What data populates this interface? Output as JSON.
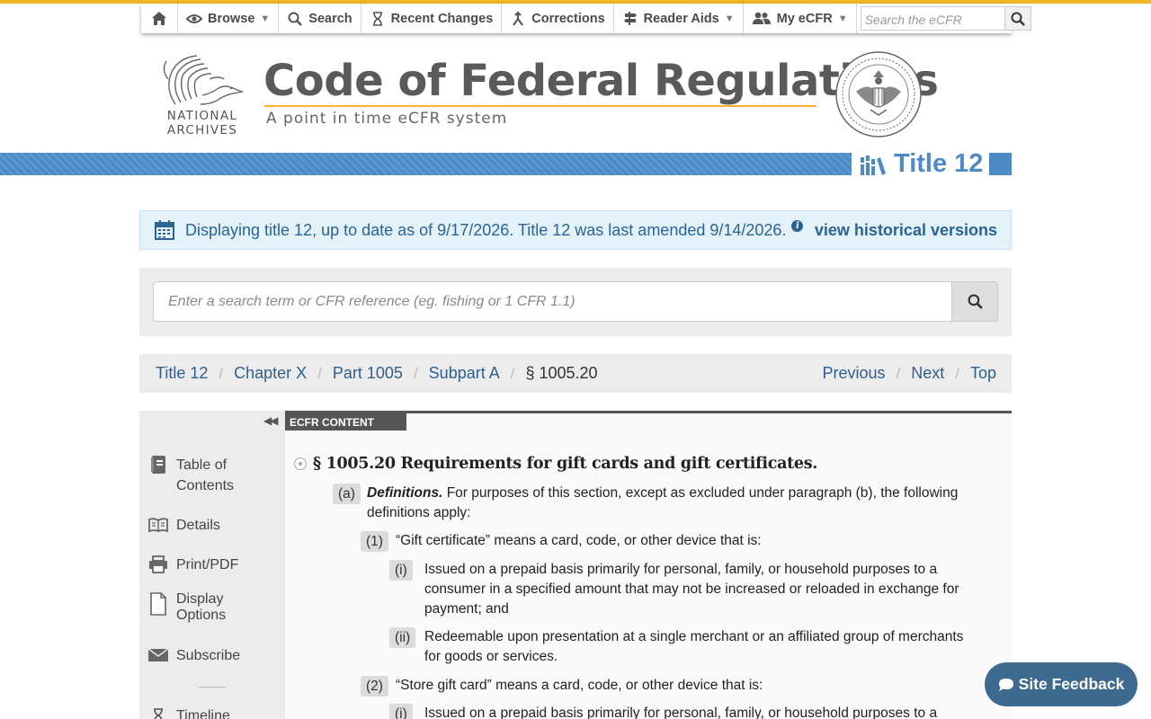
{
  "nav": {
    "browse": "Browse",
    "search": "Search",
    "recent_changes": "Recent Changes",
    "corrections": "Corrections",
    "reader_aids": "Reader Aids",
    "my_ecfr": "My eCFR",
    "search_placeholder": "Search the eCFR"
  },
  "header": {
    "org_line1": "NATIONAL",
    "org_line2": "ARCHIVES",
    "title": "Code of Federal Regulations",
    "subtitle": "A point in time eCFR system",
    "title_number": "Title 12"
  },
  "info": {
    "message": "Displaying title 12, up to date as of 9/17/2026. Title 12 was last amended 9/14/2026.",
    "info_glyph": "i",
    "historical_link": "view historical versions"
  },
  "search": {
    "placeholder": "Enter a search term or CFR reference (eg. fishing or 1 CFR 1.1)"
  },
  "breadcrumb": {
    "items": [
      "Title 12",
      "Chapter X",
      "Part 1005",
      "Subpart A",
      "§ 1005.20"
    ],
    "previous": "Previous",
    "next": "Next",
    "top": "Top"
  },
  "sidebar": {
    "collapse": "◀◀",
    "toc_line1": "Table of",
    "toc_line2": "Contents",
    "details": "Details",
    "print": "Print/PDF",
    "display_line1": "Display",
    "display_line2": "Options",
    "subscribe": "Subscribe",
    "timeline": "Timeline"
  },
  "content": {
    "tab": "ECFR CONTENT",
    "section_title": "§ 1005.20 Requirements for gift cards and gift certificates.",
    "paragraphs": [
      {
        "label": "(a)",
        "defterm": "Definitions.",
        "text": " For purposes of this section, except as excluded under paragraph (b), the following definitions apply:"
      },
      {
        "label": "(1)",
        "text": "“Gift certificate” means a card, code, or other device that is:"
      },
      {
        "label": "(i)",
        "text": "Issued on a prepaid basis primarily for personal, family, or household purposes to a consumer in a specified amount that may not be increased or reloaded in exchange for payment; and"
      },
      {
        "label": "(ii)",
        "text": "Redeemable upon presentation at a single merchant or an affiliated group of merchants for goods or services."
      },
      {
        "label": "(2)",
        "text": "“Store gift card” means a card, code, or other device that is:"
      },
      {
        "label": "(i)",
        "text": "Issued on a prepaid basis primarily for personal, family, or household purposes to a"
      }
    ]
  },
  "feedback": {
    "label": "Site Feedback"
  },
  "colors": {
    "accent_gold": "#f1b52a",
    "brand_blue": "#4d8ac6",
    "link_blue": "#2e5f8e",
    "info_bg": "#e3f1f9"
  }
}
